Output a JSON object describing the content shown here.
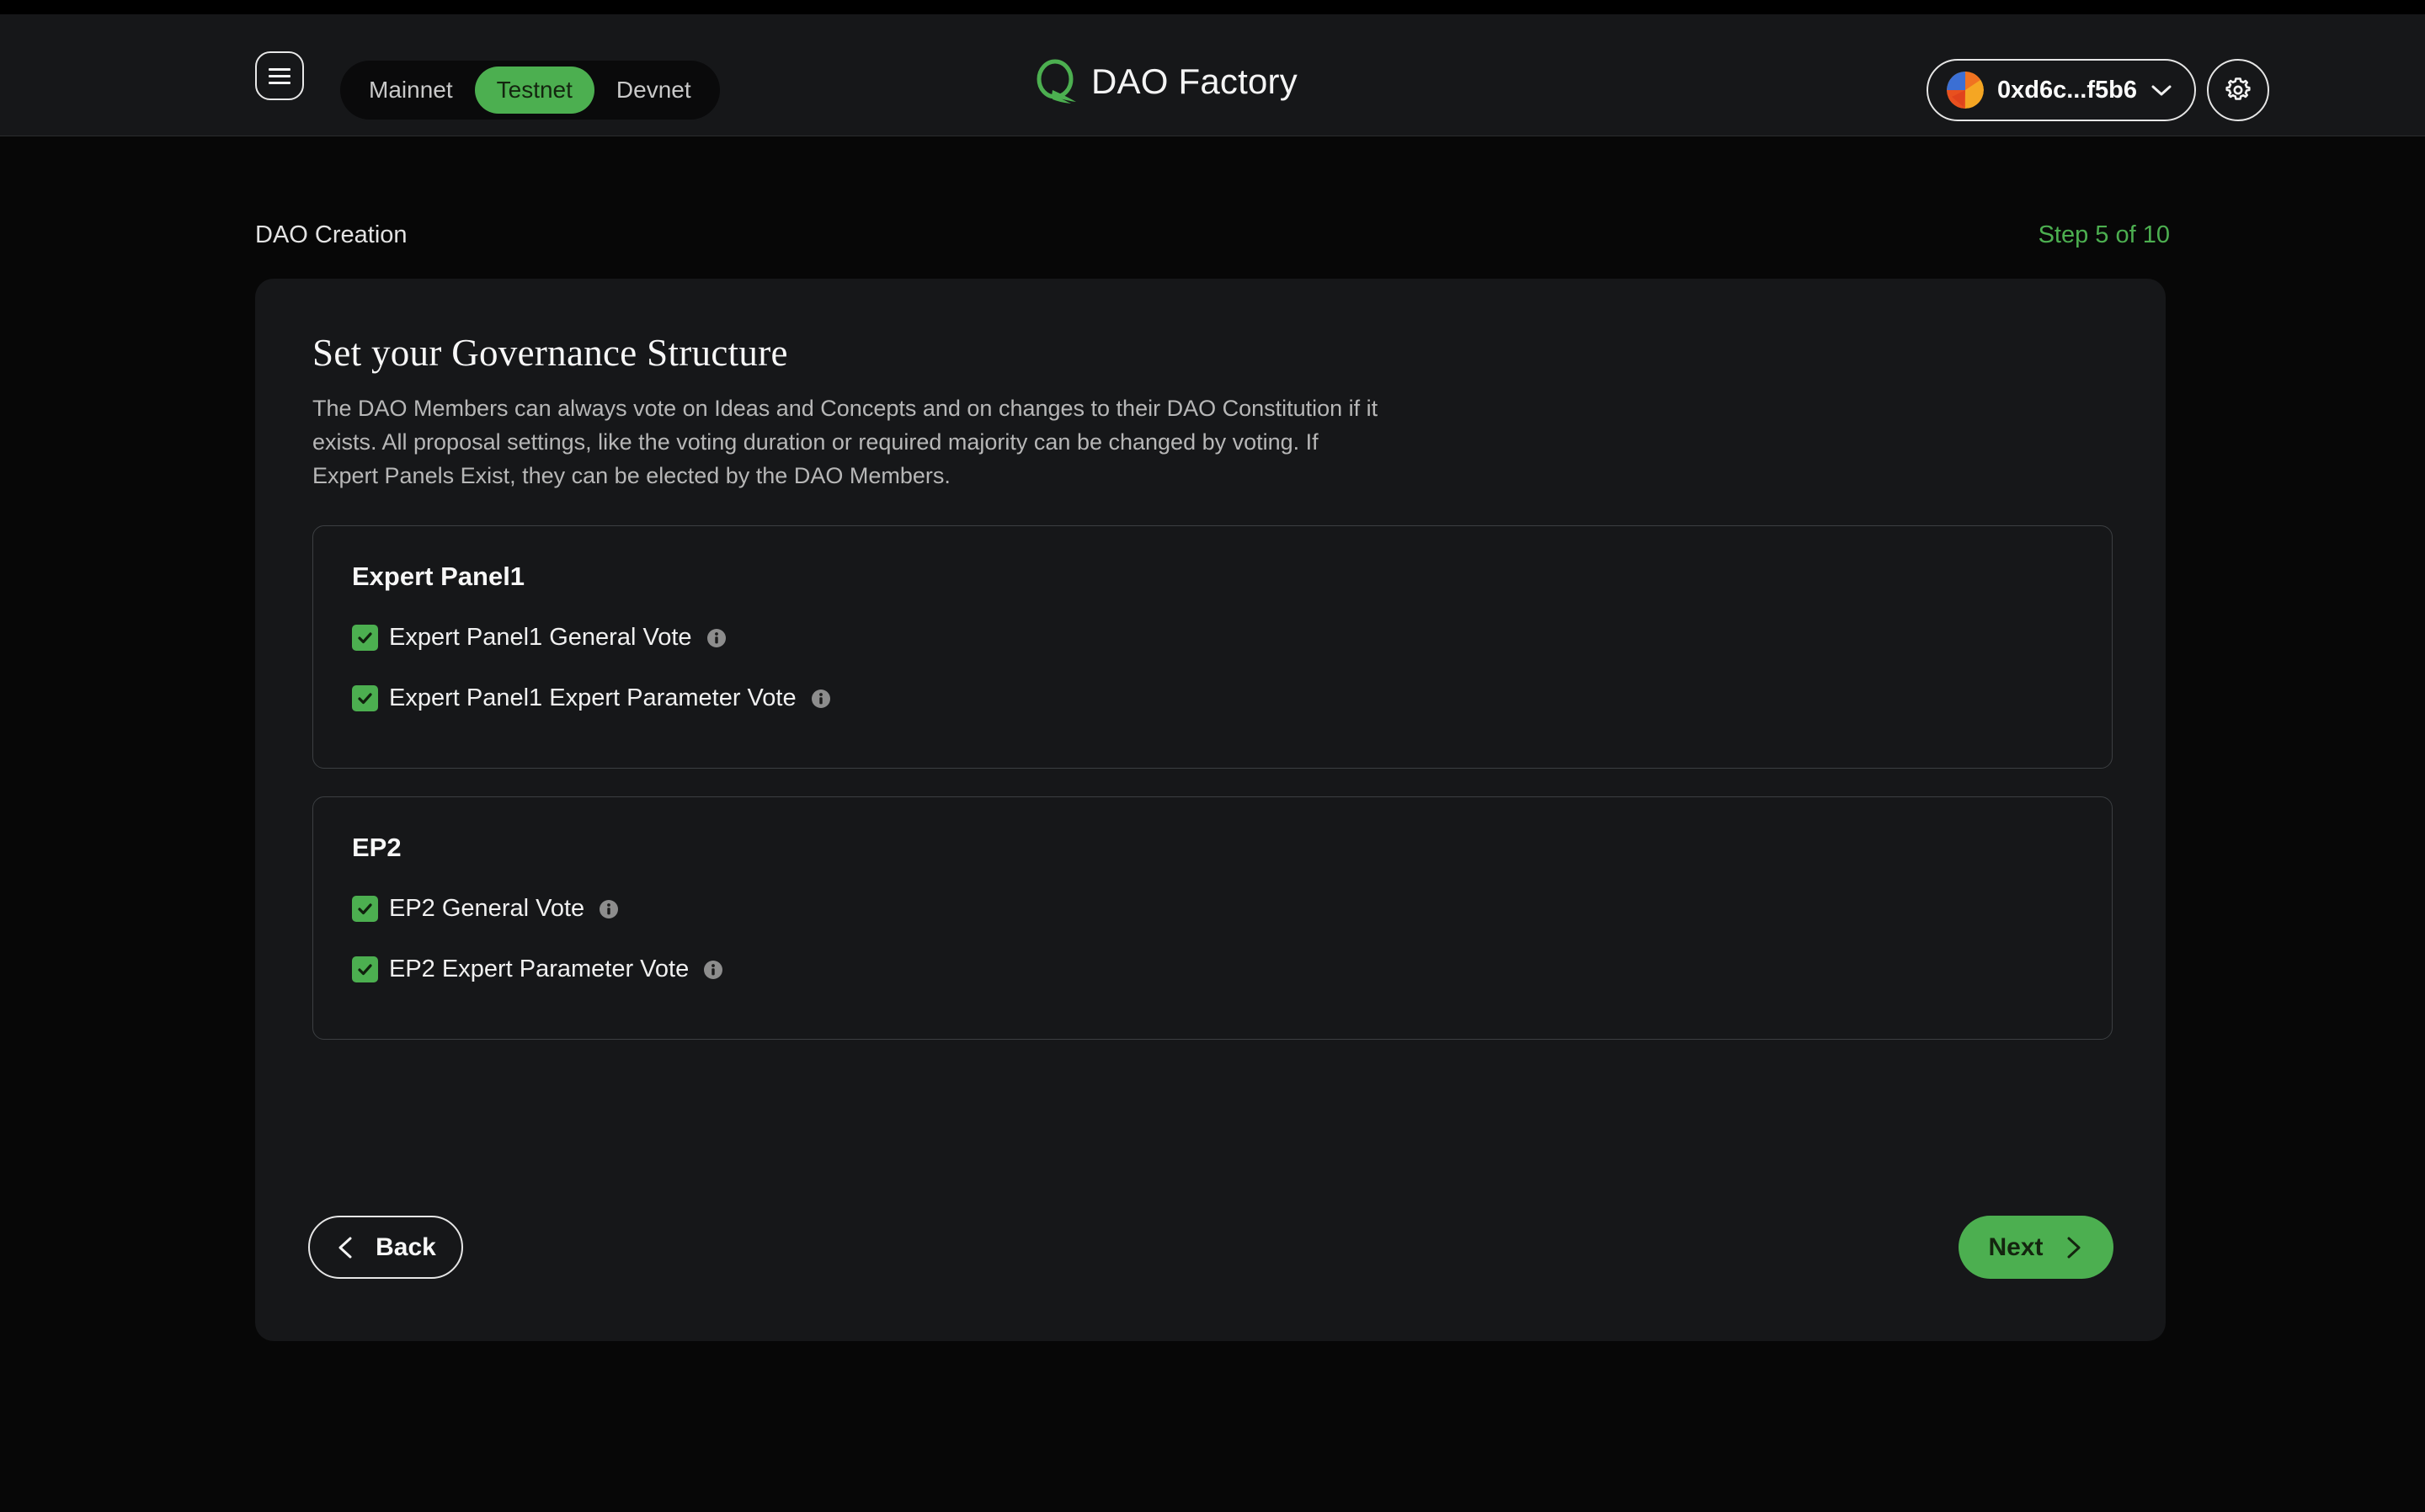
{
  "header": {
    "menu_icon": "hamburger-icon",
    "networks": [
      {
        "label": "Mainnet",
        "active": false
      },
      {
        "label": "Testnet",
        "active": true
      },
      {
        "label": "Devnet",
        "active": false
      }
    ],
    "brand": {
      "logo_icon": "q-logo-icon",
      "title": "DAO Factory"
    },
    "wallet": {
      "avatar_icon": "wallet-avatar-icon",
      "address": "0xd6c...f5b6",
      "chevron_icon": "chevron-down-icon"
    },
    "settings_icon": "gear-icon"
  },
  "breadcrumb": {
    "label": "DAO Creation",
    "step": "Step 5 of 10"
  },
  "card": {
    "title": "Set your Governance Structure",
    "description": "The DAO Members can always vote on Ideas and Concepts and on changes to their DAO Constitution if it exists. All proposal settings, like the voting duration or required majority can be changed by voting. If Expert Panels Exist, they can be elected by the DAO Members.",
    "panels": [
      {
        "name": "Expert Panel1",
        "options": [
          {
            "label": "Expert Panel1 General Vote",
            "checked": true,
            "info_icon": "info-icon"
          },
          {
            "label": "Expert Panel1 Expert Parameter Vote",
            "checked": true,
            "info_icon": "info-icon"
          }
        ]
      },
      {
        "name": "EP2",
        "options": [
          {
            "label": "EP2 General Vote",
            "checked": true,
            "info_icon": "info-icon"
          },
          {
            "label": "EP2 Expert Parameter Vote",
            "checked": true,
            "info_icon": "info-icon"
          }
        ]
      }
    ],
    "footer": {
      "back_label": "Back",
      "back_icon": "chevron-left-icon",
      "next_label": "Next",
      "next_icon": "chevron-right-icon"
    }
  },
  "colors": {
    "accent_green": "#4caf50",
    "page_bg": "#070707",
    "card_bg": "#161719",
    "panel_border": "#3c3f42",
    "text_primary": "#f4f4f4",
    "text_muted": "#b7b7b7",
    "info_gray": "#8d8d8d"
  }
}
